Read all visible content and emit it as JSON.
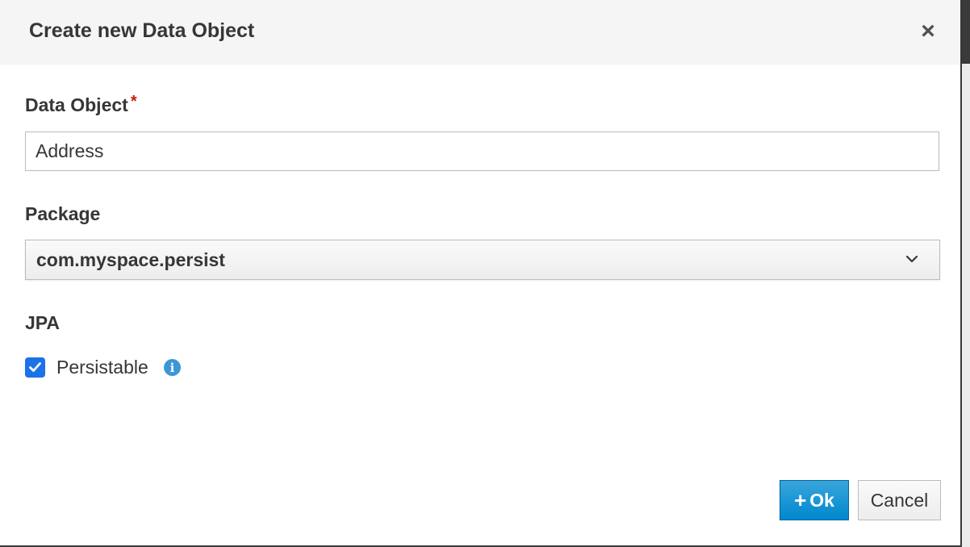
{
  "dialog": {
    "title": "Create new Data Object",
    "close_symbol": "×"
  },
  "fields": {
    "data_object": {
      "label": "Data Object",
      "required_marker": "*",
      "value": "Address"
    },
    "package": {
      "label": "Package",
      "selected": "com.myspace.persist",
      "icon": "chevron-down-icon"
    },
    "jpa": {
      "label": "JPA",
      "checkbox_label": "Persistable",
      "checked": true,
      "info_symbol": "i"
    }
  },
  "buttons": {
    "ok_icon": "+",
    "ok_label": "Ok",
    "cancel_label": "Cancel"
  },
  "colors": {
    "primary": "#0088ce",
    "checkbox": "#1c72e8",
    "info": "#3c96d8",
    "required": "#c9190b"
  }
}
